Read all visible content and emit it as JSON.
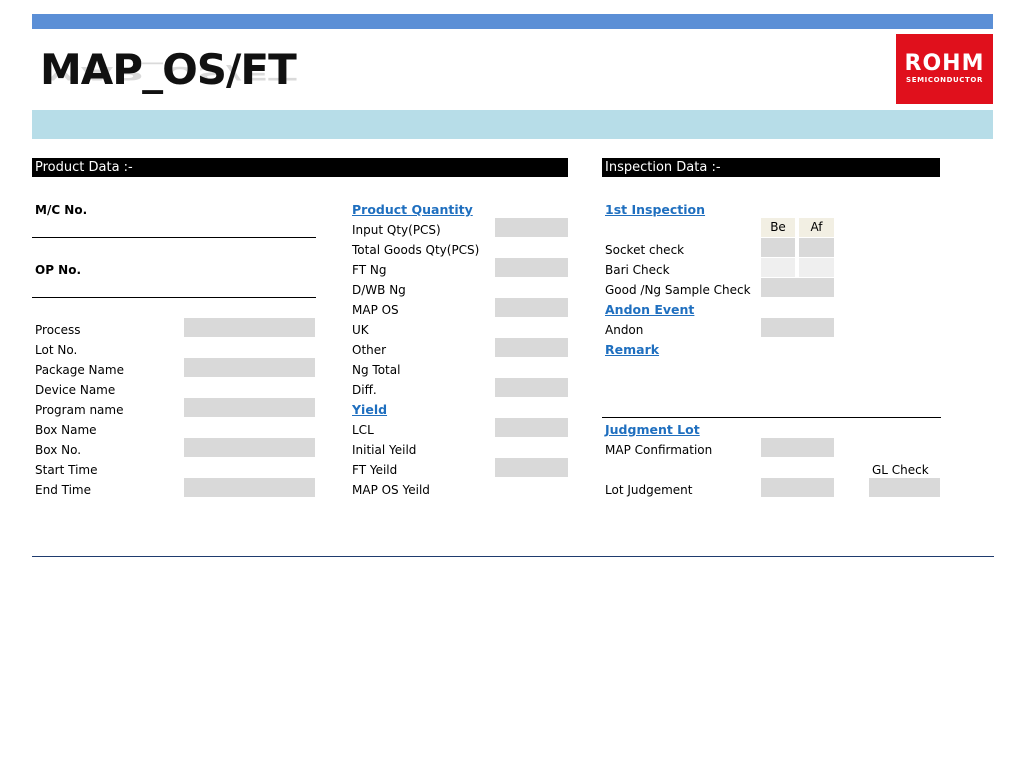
{
  "header": {
    "title": "MAP_OS/FT",
    "logo_main": "ROHM",
    "logo_sub": "SEMICONDUCTOR"
  },
  "product": {
    "section_title": "Product Data :-",
    "mc_no": "M/C No.",
    "op_no": "OP  No.",
    "fields": [
      "Process",
      "Lot  No.",
      "Package Name",
      "Device Name",
      "Program name",
      "Box Name",
      "Box No.",
      "Start Time",
      "End Time"
    ]
  },
  "quantity": {
    "heading": "Product Quantity",
    "fields": [
      "Input Qty(PCS)",
      "Total Goods Qty(PCS)",
      "FT Ng",
      "D/WB Ng",
      "MAP OS",
      "UK",
      "Other",
      "Ng Total",
      "Diff."
    ],
    "yield_heading": "Yield ",
    "yield_fields": [
      "LCL",
      "Initial Yeild",
      "FT Yeild",
      "MAP OS Yeild"
    ]
  },
  "inspection": {
    "section_title": "Inspection Data :-",
    "first_heading": "1st Inspection",
    "col_be": "Be",
    "col_af": "Af",
    "socket": "Socket check",
    "bari": "Bari Check",
    "goodng": "Good /Ng Sample Check",
    "andon_heading": "Andon Event",
    "andon": "Andon",
    "remark_heading": "Remark",
    "judgment_heading": "Judgment Lot",
    "map_conf": "MAP Confirmation",
    "gl_check": "GL Check",
    "lot_judgement": "Lot Judgement"
  },
  "colors": {
    "top_bar": "#5b8fd6",
    "light_bar": "#b7dde8",
    "logo": "#e0101c",
    "link": "#1f6fbf"
  }
}
